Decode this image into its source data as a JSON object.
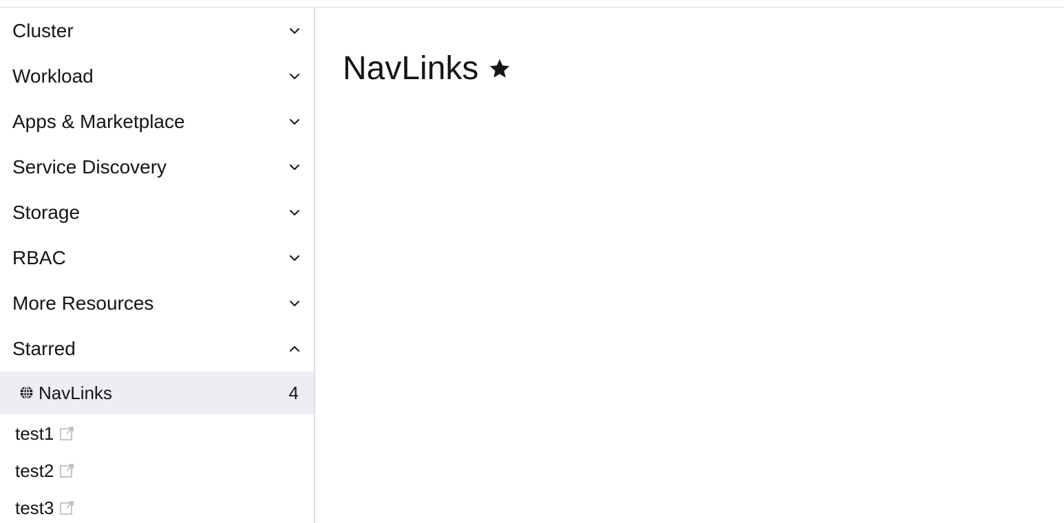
{
  "sidebar": {
    "groups": [
      {
        "label": "Cluster",
        "icon": "chevron-down-icon"
      },
      {
        "label": "Workload",
        "icon": "chevron-down-icon"
      },
      {
        "label": "Apps & Marketplace",
        "icon": "chevron-down-icon"
      },
      {
        "label": "Service Discovery",
        "icon": "chevron-down-icon"
      },
      {
        "label": "Storage",
        "icon": "chevron-down-icon"
      },
      {
        "label": "RBAC",
        "icon": "chevron-down-icon"
      },
      {
        "label": "More Resources",
        "icon": "chevron-down-icon"
      },
      {
        "label": "Starred",
        "icon": "chevron-up-icon"
      }
    ],
    "starred_active": {
      "label": "NavLinks",
      "count": "4",
      "icon": "globe-icon"
    },
    "links": [
      {
        "label": "test1",
        "icon": "external-link-icon"
      },
      {
        "label": "test2",
        "icon": "external-link-icon"
      },
      {
        "label": "test3",
        "icon": "external-link-icon"
      }
    ]
  },
  "main": {
    "title": "NavLinks",
    "title_icon": "star-icon"
  },
  "colors": {
    "text": "#141419",
    "active_bg": "#eceef2",
    "border": "#dcdee7",
    "muted_icon": "#b5b8c4"
  }
}
